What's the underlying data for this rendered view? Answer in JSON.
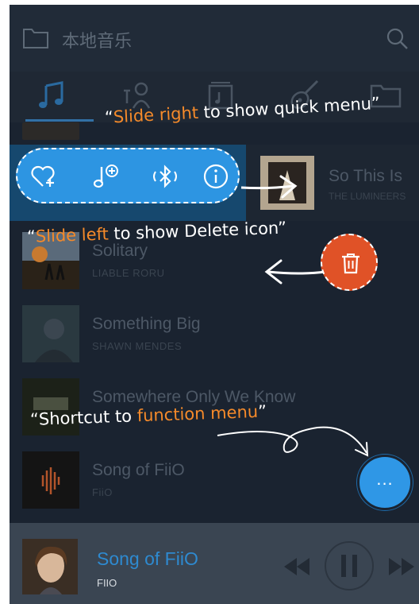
{
  "header": {
    "title": "本地音乐",
    "icons": [
      "folder-icon",
      "search-icon"
    ]
  },
  "tabs": [
    {
      "name": "songs",
      "icon": "music-note-icon",
      "active": true
    },
    {
      "name": "artists",
      "icon": "artist-icon"
    },
    {
      "name": "albums",
      "icon": "album-icon"
    },
    {
      "name": "genres",
      "icon": "guitar-icon"
    },
    {
      "name": "folders",
      "icon": "folder-icon"
    }
  ],
  "songs": [
    {
      "title": "Solitary",
      "artist": "LIABLE RORU"
    },
    {
      "title": "Something Big",
      "artist": "SHAWN MENDES"
    },
    {
      "title": "Somewhere Only We Know",
      "artist": ""
    },
    {
      "title": "Song of FiiO",
      "artist": "FiiO"
    }
  ],
  "swiped_row": {
    "title": "So This Is",
    "artist": "THE LUMINEERS"
  },
  "quick_menu": {
    "icons": [
      "favorite-add-icon",
      "playlist-add-icon",
      "bluetooth-icon",
      "info-icon"
    ]
  },
  "hints": {
    "slide_right_highlight": "Slide right",
    "slide_right_rest": " to show quick menu",
    "slide_left_highlight": "Slide left",
    "slide_left_rest": " to show Delete icon",
    "shortcut_prefix": "Shortcut to ",
    "shortcut_highlight": "function menu"
  },
  "fab": {
    "label": "..."
  },
  "player": {
    "title": "Song of FiiO",
    "artist": "FIIO"
  },
  "colors": {
    "accent_blue": "#2d95e2",
    "hint_orange": "#f58a2a",
    "delete_red": "#e05227",
    "background": "#1a2330"
  }
}
